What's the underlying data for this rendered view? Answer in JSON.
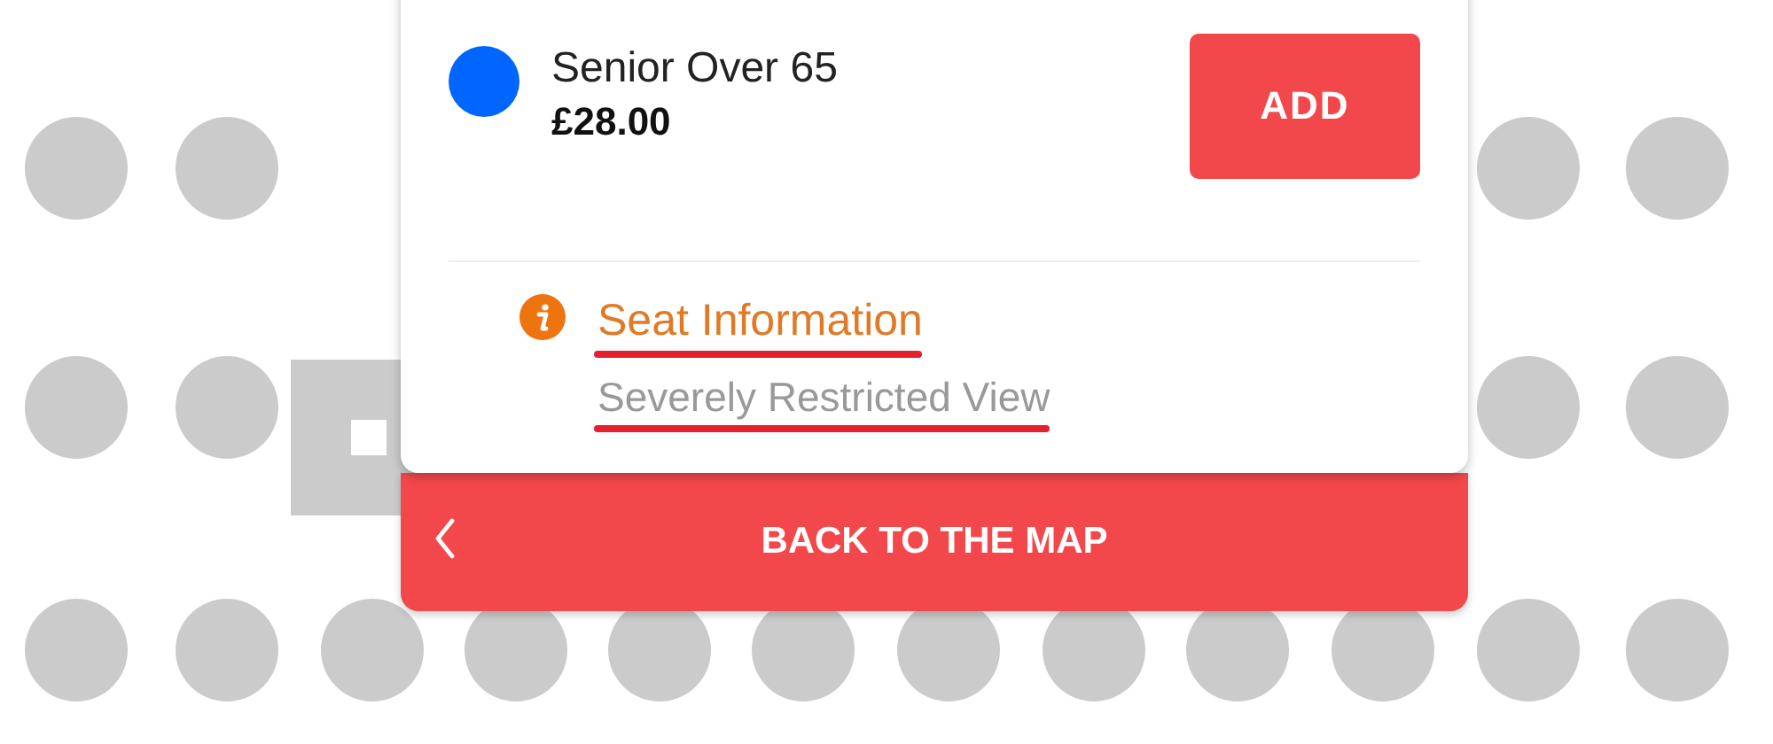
{
  "ticket": {
    "name": "Senior Over 65",
    "price": "£28.00",
    "color": "#0066ff"
  },
  "add_button": {
    "label": "ADD"
  },
  "seat_info": {
    "title": "Seat Information",
    "description": "Severely Restricted View"
  },
  "back_button": {
    "label": "BACK TO THE MAP"
  }
}
